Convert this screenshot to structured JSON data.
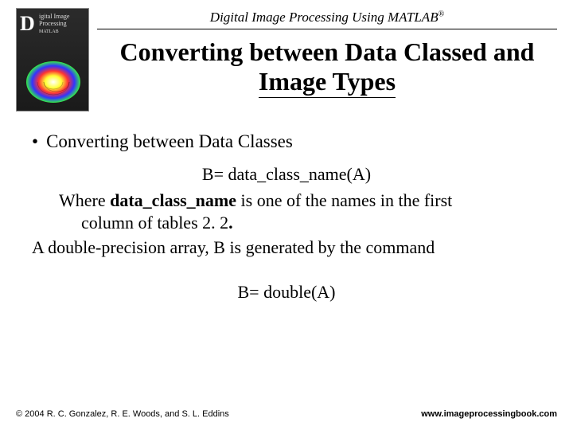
{
  "header": {
    "running_head": "Digital Image Processing Using MATLAB",
    "registered": "®"
  },
  "title": {
    "line1": "Converting between Data Classed and",
    "line2": "Image Types"
  },
  "bullet1": "Converting between Data Classes",
  "formula1": "B= data_class_name(A)",
  "para": {
    "lead": "Where ",
    "bold": "data_class_name",
    "rest1": " is one of the names in the first",
    "rest2": "column of tables 2. 2",
    "dot": "."
  },
  "para2": "A double-precision array, B is generated by the command",
  "formula2": "B= double(A)",
  "footer": {
    "copyright": "© 2004 R. C. Gonzalez, R. E. Woods, and S. L. Eddins",
    "url": "www.imageprocessingbook.com"
  },
  "cover": {
    "d": "D",
    "t1": "igital Image",
    "t2": "Processing",
    "matlab": "MATLAB"
  }
}
